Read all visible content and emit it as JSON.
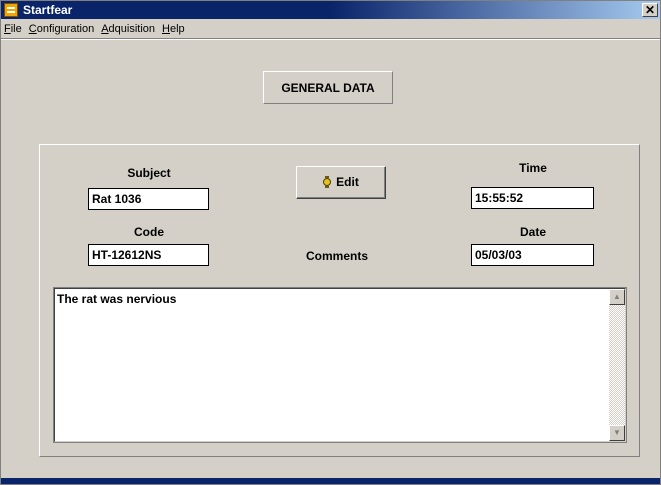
{
  "window": {
    "title": "Startfear",
    "close_glyph": "✕"
  },
  "menu": [
    {
      "hotkey": "F",
      "rest": "ile"
    },
    {
      "hotkey": "C",
      "rest": "onfiguration"
    },
    {
      "hotkey": "A",
      "rest": "dquisition"
    },
    {
      "hotkey": "H",
      "rest": "elp"
    }
  ],
  "header": {
    "label": "GENERAL DATA"
  },
  "form": {
    "subject_label": "Subject",
    "subject_value": "Rat 1036",
    "code_label": "Code",
    "code_value": "HT-12612NS",
    "time_label": "Time",
    "time_value": "15:55:52",
    "date_label": "Date",
    "date_value": "05/03/03",
    "comments_label": "Comments",
    "comments_value": "The rat was nervious",
    "edit_label": "Edit"
  },
  "icons": {
    "app": "stopwatch-app-icon",
    "edit": "stopwatch-icon",
    "scroll_up": "scroll-up-arrow-icon",
    "scroll_down": "scroll-down-arrow-icon"
  },
  "scroll_glyphs": {
    "up": "▲",
    "down": "▼"
  },
  "colors": {
    "titlebar": "#0a246a",
    "face": "#d4d0c8",
    "accent": "#e8c21a"
  }
}
